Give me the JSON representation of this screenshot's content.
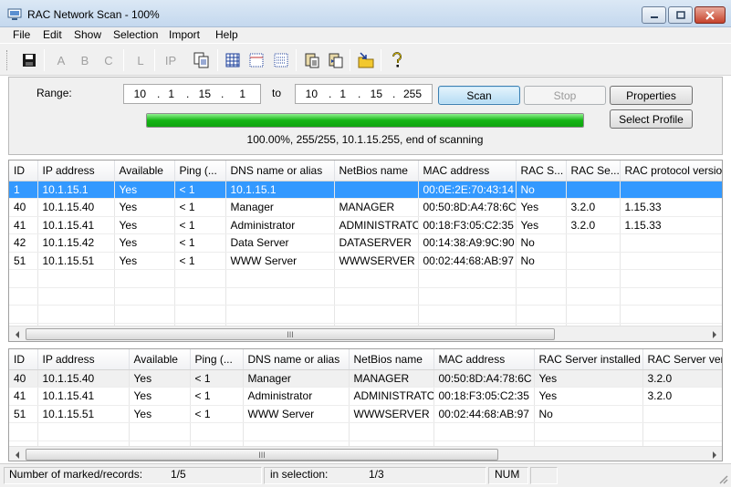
{
  "window": {
    "title": "RAC Network Scan - 100%"
  },
  "menu": [
    "File",
    "Edit",
    "Show",
    "Selection",
    "Import",
    "Help"
  ],
  "toolbar": {
    "letters": {
      "a": "A",
      "b": "B",
      "c": "C",
      "l": "L",
      "ip": "IP"
    }
  },
  "range": {
    "label": "Range:",
    "to_label": "to",
    "from": [
      "10",
      "1",
      "15",
      "1"
    ],
    "to": [
      "10",
      "1",
      "15",
      "255"
    ],
    "dot": "."
  },
  "buttons": {
    "scan": "Scan",
    "stop": "Stop",
    "properties": "Properties",
    "select_profile": "Select Profile"
  },
  "progress": {
    "percent": 100,
    "text": "100.00%, 255/255, 10.1.15.255, end of scanning"
  },
  "top_table": {
    "columns": [
      "ID",
      "IP address",
      "Available",
      "Ping (...",
      "DNS name or alias",
      "NetBios name",
      "MAC address",
      "RAC S...",
      "RAC Se...",
      "RAC protocol versio"
    ],
    "rows": [
      [
        "1",
        "10.1.15.1",
        "Yes",
        "< 1",
        "10.1.15.1",
        "",
        "00:0E:2E:70:43:14",
        "No",
        "",
        ""
      ],
      [
        "40",
        "10.1.15.40",
        "Yes",
        "< 1",
        "Manager",
        "MANAGER",
        "00:50:8D:A4:78:6C",
        "Yes",
        "3.2.0",
        "1.15.33"
      ],
      [
        "41",
        "10.1.15.41",
        "Yes",
        "< 1",
        "Administrator",
        "ADMINISTRATOR",
        "00:18:F3:05:C2:35",
        "Yes",
        "3.2.0",
        "1.15.33"
      ],
      [
        "42",
        "10.1.15.42",
        "Yes",
        "< 1",
        "Data Server",
        "DATASERVER",
        "00:14:38:A9:9C:90",
        "No",
        "",
        ""
      ],
      [
        "51",
        "10.1.15.51",
        "Yes",
        "< 1",
        "WWW Server",
        "WWWSERVER",
        "00:02:44:68:AB:97",
        "No",
        "",
        ""
      ]
    ]
  },
  "bottom_table": {
    "columns": [
      "ID",
      "IP address",
      "Available",
      "Ping (...",
      "DNS name or alias",
      "NetBios name",
      "MAC address",
      "RAC Server installed",
      "RAC Server vers"
    ],
    "rows": [
      [
        "40",
        "10.1.15.40",
        "Yes",
        "< 1",
        "Manager",
        "MANAGER",
        "00:50:8D:A4:78:6C",
        "Yes",
        "3.2.0"
      ],
      [
        "41",
        "10.1.15.41",
        "Yes",
        "< 1",
        "Administrator",
        "ADMINISTRATOR",
        "00:18:F3:05:C2:35",
        "Yes",
        "3.2.0"
      ],
      [
        "51",
        "10.1.15.51",
        "Yes",
        "< 1",
        "WWW Server",
        "WWWSERVER",
        "00:02:44:68:AB:97",
        "No",
        ""
      ]
    ]
  },
  "scroll_grip": "III",
  "status": {
    "records_label": "Number of marked/records:",
    "records_value": "1/5",
    "selection_label": "in selection:",
    "selection_value": "1/3",
    "num": "NUM"
  },
  "colors": {
    "selection": "#3399ff",
    "progress": "#15b515",
    "scan_button": "#b5dcf4"
  }
}
